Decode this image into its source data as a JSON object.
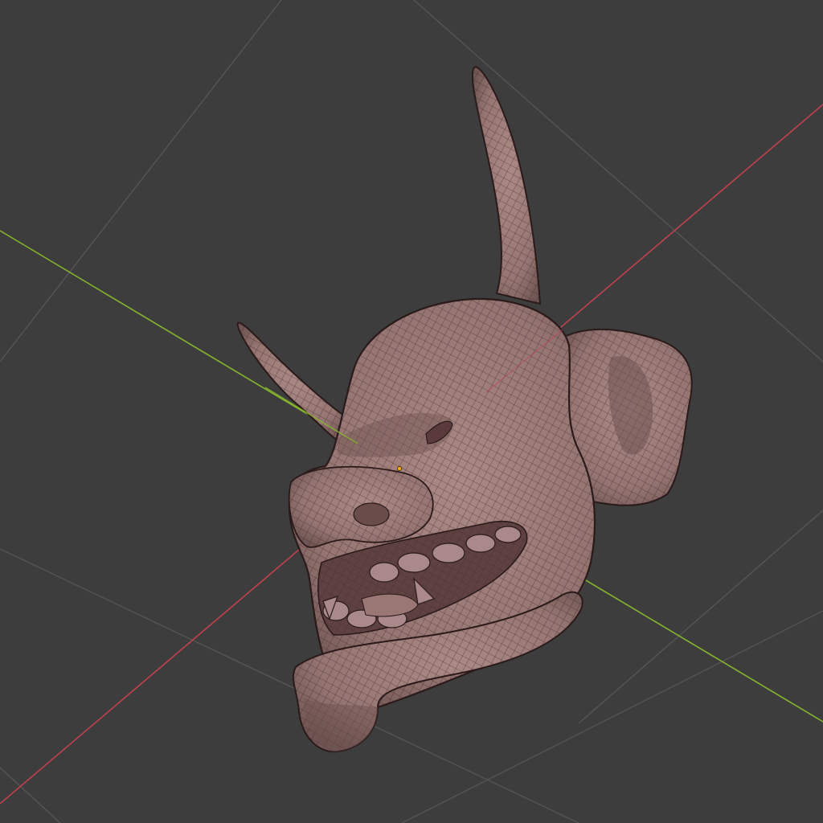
{
  "viewport": {
    "background_color": "#3d3d3d",
    "grid_color": "#555555",
    "x_axis_color": "#c2414f",
    "y_axis_color": "#86b52d",
    "mesh_color": "#9c7c79",
    "wire_color": "#3a2323",
    "origin_color": "#ffb000",
    "mesh_icon": "onitsura-oni-mask-mesh"
  }
}
